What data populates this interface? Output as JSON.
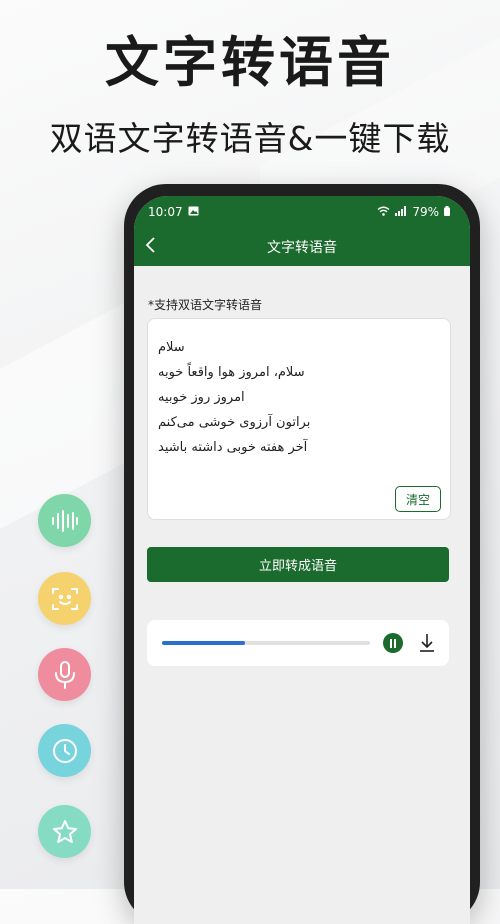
{
  "promo": {
    "headline": "文字转语音",
    "subline": "双语文字转语音&一键下载"
  },
  "status_bar": {
    "time": "10:07",
    "battery": "79%",
    "icons": [
      "image-icon",
      "wifi-icon",
      "signal-icon",
      "battery-icon"
    ]
  },
  "nav": {
    "title": "文字转语音",
    "back_icon": "chevron-left-icon"
  },
  "hint": "*支持双语文字转语音",
  "input": {
    "lines": [
      "سلام",
      "سلام، امروز هوا واقعاً خوبه",
      "امروز روز خوبیه",
      "براتون آرزوی خوشی می‌کنم",
      "آخر هفته خوبی داشته باشید"
    ],
    "clear_label": "清空"
  },
  "convert_label": "立即转成语音",
  "player": {
    "progress": 0.4,
    "pause_icon": "pause-icon",
    "download_icon": "download-icon"
  },
  "features": [
    {
      "icon": "sound-wave-icon",
      "color": "#7fd6a8"
    },
    {
      "icon": "face-scan-icon",
      "color": "#f6d26e"
    },
    {
      "icon": "microphone-icon",
      "color": "#ef8c9e"
    },
    {
      "icon": "clock-icon",
      "color": "#77d4dd"
    },
    {
      "icon": "star-icon",
      "color": "#86dcc2"
    }
  ],
  "colors": {
    "brand_green": "#1c6b2e",
    "progress_blue": "#2b6fcf"
  }
}
